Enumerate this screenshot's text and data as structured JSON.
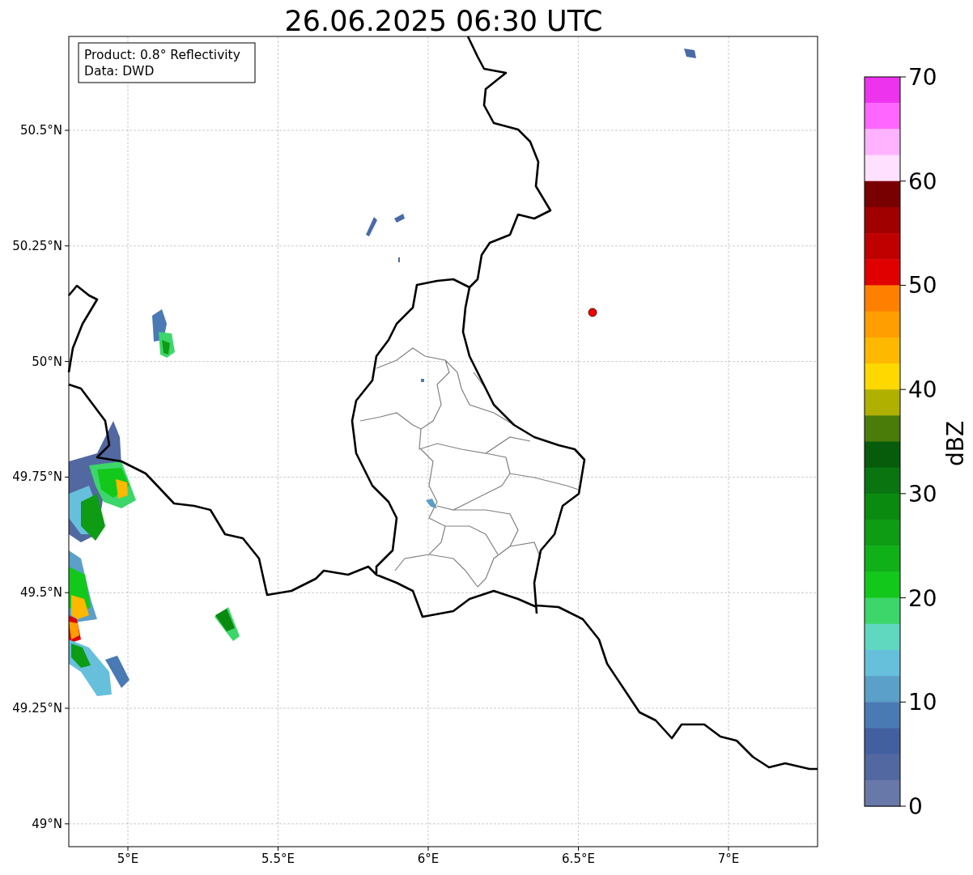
{
  "title": "26.06.2025 06:30 UTC",
  "legend": [
    "Product: 0.8° Reflectivity",
    "Data: DWD"
  ],
  "map": {
    "x_ticks": [
      "5°E",
      "5.5°E",
      "6°E",
      "6.5°E",
      "7°E"
    ],
    "y_ticks": [
      "50.5°N",
      "50.25°N",
      "50°N",
      "49.75°N",
      "49.5°N",
      "49.25°N",
      "49°N"
    ]
  },
  "colorbar": {
    "label": "dBZ",
    "ticks": [
      "70",
      "60",
      "50",
      "40",
      "30",
      "20",
      "10",
      "0"
    ],
    "segments": [
      {
        "color": "#ee33ee"
      },
      {
        "color": "#ff66ff"
      },
      {
        "color": "#ffb3ff"
      },
      {
        "color": "#ffe0ff"
      },
      {
        "color": "#780000"
      },
      {
        "color": "#a00000"
      },
      {
        "color": "#c00000"
      },
      {
        "color": "#e00000"
      },
      {
        "color": "#ff8000"
      },
      {
        "color": "#ff9e00"
      },
      {
        "color": "#ffb800"
      },
      {
        "color": "#ffd800"
      },
      {
        "color": "#b0b000"
      },
      {
        "color": "#4a7c0a"
      },
      {
        "color": "#065c0a"
      },
      {
        "color": "#0a7510"
      },
      {
        "color": "#0b8a10"
      },
      {
        "color": "#0e9c14"
      },
      {
        "color": "#10b018"
      },
      {
        "color": "#12c81a"
      },
      {
        "color": "#3cd66a"
      },
      {
        "color": "#60d8c0"
      },
      {
        "color": "#66c0dc"
      },
      {
        "color": "#5aa0c8"
      },
      {
        "color": "#4a7ab4"
      },
      {
        "color": "#4260a0"
      },
      {
        "color": "#5268a0"
      },
      {
        "color": "#6878a8"
      }
    ]
  }
}
